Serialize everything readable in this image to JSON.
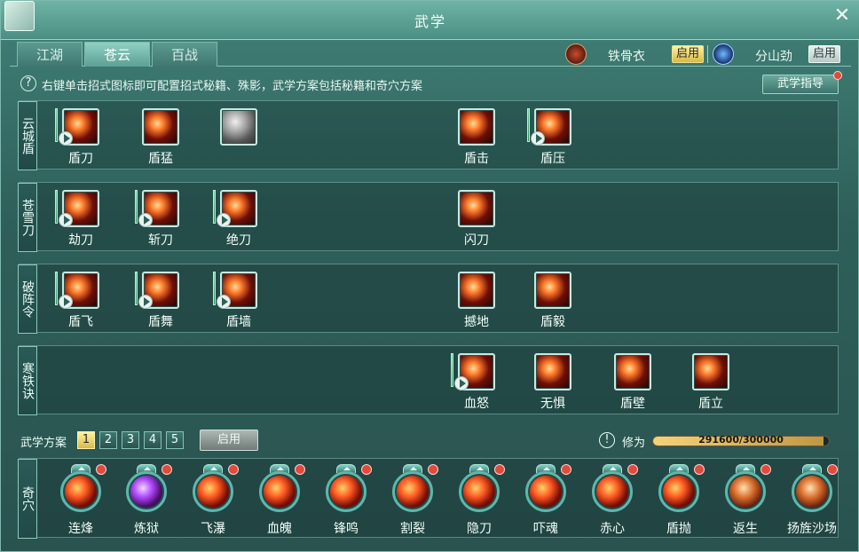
{
  "window": {
    "title": "武学",
    "close_icon": "close-icon"
  },
  "tabs": [
    {
      "label": "江湖",
      "active": false
    },
    {
      "label": "苍云",
      "active": true
    },
    {
      "label": "百战",
      "active": false
    }
  ],
  "modes": [
    {
      "name": "铁骨衣",
      "button": "启用",
      "state": "active",
      "icon": "shield-emblem-icon"
    },
    {
      "name": "分山劲",
      "button": "启用",
      "state": "inactive",
      "icon": "crescent-moon-icon"
    }
  ],
  "hint": {
    "icon": "question-icon",
    "text": "右键单击招式图标即可配置招式秘籍、殊影，武学方案包括秘籍和奇穴方案",
    "guide_button": "武学指导"
  },
  "skill_rows": [
    {
      "label": "云城盾",
      "skills": [
        {
          "name": "盾刀",
          "icon": "shield-blade-icon",
          "has_play": true,
          "has_bar": true,
          "style": "dark"
        },
        {
          "name": "盾猛",
          "icon": "shield-charge-icon",
          "has_play": false,
          "has_bar": false,
          "style": "dark"
        },
        {
          "name": "",
          "icon": "stone-shield-icon",
          "has_play": false,
          "has_bar": false,
          "style": "gray"
        },
        {
          "name": "盾击",
          "icon": "shield-strike-icon",
          "has_play": false,
          "has_bar": false,
          "style": "dark"
        },
        {
          "name": "盾压",
          "icon": "shield-press-icon",
          "has_play": true,
          "has_bar": true,
          "style": "dark"
        }
      ]
    },
    {
      "label": "苍雪刀",
      "skills": [
        {
          "name": "劫刀",
          "icon": "slash-icon",
          "has_play": true,
          "has_bar": true,
          "style": "dark"
        },
        {
          "name": "斩刀",
          "icon": "cut-icon",
          "has_play": true,
          "has_bar": true,
          "style": "dark"
        },
        {
          "name": "绝刀",
          "icon": "final-blade-icon",
          "has_play": true,
          "has_bar": true,
          "style": "dark"
        },
        {
          "name": "闪刀",
          "icon": "flash-blade-icon",
          "has_play": false,
          "has_bar": false,
          "style": "dark"
        }
      ]
    },
    {
      "label": "破阵令",
      "skills": [
        {
          "name": "盾飞",
          "icon": "shield-fly-icon",
          "has_play": true,
          "has_bar": true,
          "style": "dark"
        },
        {
          "name": "盾舞",
          "icon": "shield-dance-icon",
          "has_play": true,
          "has_bar": true,
          "style": "dark"
        },
        {
          "name": "盾墙",
          "icon": "shield-wall-icon",
          "has_play": true,
          "has_bar": true,
          "style": "dark"
        },
        {
          "name": "撼地",
          "icon": "earth-shake-icon",
          "has_play": false,
          "has_bar": false,
          "style": "dark"
        },
        {
          "name": "盾毅",
          "icon": "shield-will-icon",
          "has_play": false,
          "has_bar": false,
          "style": "dark"
        }
      ]
    },
    {
      "label": "寒铁诀",
      "skills": [
        {
          "name": "血怒",
          "icon": "blood-rage-icon",
          "has_play": true,
          "has_bar": true,
          "style": "dark"
        },
        {
          "name": "无惧",
          "icon": "fearless-icon",
          "has_play": false,
          "has_bar": false,
          "style": "dark"
        },
        {
          "name": "盾壁",
          "icon": "shield-barrier-icon",
          "has_play": false,
          "has_bar": false,
          "style": "dark"
        },
        {
          "name": "盾立",
          "icon": "shield-stand-icon",
          "has_play": false,
          "has_bar": false,
          "style": "dark"
        }
      ]
    }
  ],
  "plans": {
    "label": "武学方案",
    "numbers": [
      "1",
      "2",
      "3",
      "4",
      "5"
    ],
    "active_index": 0,
    "apply_button": "启用"
  },
  "cultivation": {
    "icon": "exclamation-icon",
    "label": "修为",
    "current": 291600,
    "max": 300000,
    "text": "291600/300000"
  },
  "qixue": {
    "label": "奇穴",
    "items": [
      {
        "name": "连烽",
        "icon": "fire-chain-icon",
        "style": "fire"
      },
      {
        "name": "炼狱",
        "icon": "purgatory-icon",
        "style": "purple"
      },
      {
        "name": "飞瀑",
        "icon": "waterfall-icon",
        "style": "fire"
      },
      {
        "name": "血魄",
        "icon": "blood-soul-icon",
        "style": "fire"
      },
      {
        "name": "锋鸣",
        "icon": "blade-cry-icon",
        "style": "fire"
      },
      {
        "name": "割裂",
        "icon": "rend-icon",
        "style": "fire"
      },
      {
        "name": "隐刀",
        "icon": "hidden-blade-icon",
        "style": "fire"
      },
      {
        "name": "吓魂",
        "icon": "soul-scare-icon",
        "style": "fire"
      },
      {
        "name": "赤心",
        "icon": "red-heart-icon",
        "style": "fire"
      },
      {
        "name": "盾抛",
        "icon": "shield-toss-icon",
        "style": "fire"
      },
      {
        "name": "返生",
        "icon": "revive-icon",
        "style": "shield"
      },
      {
        "name": "扬旌沙场",
        "icon": "banner-field-icon",
        "style": "shield"
      }
    ]
  }
}
